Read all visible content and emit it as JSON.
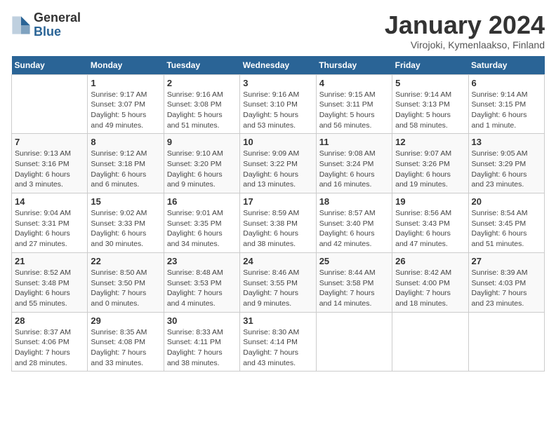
{
  "header": {
    "logo_general": "General",
    "logo_blue": "Blue",
    "title": "January 2024",
    "subtitle": "Virojoki, Kymenlaakso, Finland"
  },
  "weekdays": [
    "Sunday",
    "Monday",
    "Tuesday",
    "Wednesday",
    "Thursday",
    "Friday",
    "Saturday"
  ],
  "weeks": [
    [
      {
        "day": "",
        "info": ""
      },
      {
        "day": "1",
        "info": "Sunrise: 9:17 AM\nSunset: 3:07 PM\nDaylight: 5 hours\nand 49 minutes."
      },
      {
        "day": "2",
        "info": "Sunrise: 9:16 AM\nSunset: 3:08 PM\nDaylight: 5 hours\nand 51 minutes."
      },
      {
        "day": "3",
        "info": "Sunrise: 9:16 AM\nSunset: 3:10 PM\nDaylight: 5 hours\nand 53 minutes."
      },
      {
        "day": "4",
        "info": "Sunrise: 9:15 AM\nSunset: 3:11 PM\nDaylight: 5 hours\nand 56 minutes."
      },
      {
        "day": "5",
        "info": "Sunrise: 9:14 AM\nSunset: 3:13 PM\nDaylight: 5 hours\nand 58 minutes."
      },
      {
        "day": "6",
        "info": "Sunrise: 9:14 AM\nSunset: 3:15 PM\nDaylight: 6 hours\nand 1 minute."
      }
    ],
    [
      {
        "day": "7",
        "info": "Sunrise: 9:13 AM\nSunset: 3:16 PM\nDaylight: 6 hours\nand 3 minutes."
      },
      {
        "day": "8",
        "info": "Sunrise: 9:12 AM\nSunset: 3:18 PM\nDaylight: 6 hours\nand 6 minutes."
      },
      {
        "day": "9",
        "info": "Sunrise: 9:10 AM\nSunset: 3:20 PM\nDaylight: 6 hours\nand 9 minutes."
      },
      {
        "day": "10",
        "info": "Sunrise: 9:09 AM\nSunset: 3:22 PM\nDaylight: 6 hours\nand 13 minutes."
      },
      {
        "day": "11",
        "info": "Sunrise: 9:08 AM\nSunset: 3:24 PM\nDaylight: 6 hours\nand 16 minutes."
      },
      {
        "day": "12",
        "info": "Sunrise: 9:07 AM\nSunset: 3:26 PM\nDaylight: 6 hours\nand 19 minutes."
      },
      {
        "day": "13",
        "info": "Sunrise: 9:05 AM\nSunset: 3:29 PM\nDaylight: 6 hours\nand 23 minutes."
      }
    ],
    [
      {
        "day": "14",
        "info": "Sunrise: 9:04 AM\nSunset: 3:31 PM\nDaylight: 6 hours\nand 27 minutes."
      },
      {
        "day": "15",
        "info": "Sunrise: 9:02 AM\nSunset: 3:33 PM\nDaylight: 6 hours\nand 30 minutes."
      },
      {
        "day": "16",
        "info": "Sunrise: 9:01 AM\nSunset: 3:35 PM\nDaylight: 6 hours\nand 34 minutes."
      },
      {
        "day": "17",
        "info": "Sunrise: 8:59 AM\nSunset: 3:38 PM\nDaylight: 6 hours\nand 38 minutes."
      },
      {
        "day": "18",
        "info": "Sunrise: 8:57 AM\nSunset: 3:40 PM\nDaylight: 6 hours\nand 42 minutes."
      },
      {
        "day": "19",
        "info": "Sunrise: 8:56 AM\nSunset: 3:43 PM\nDaylight: 6 hours\nand 47 minutes."
      },
      {
        "day": "20",
        "info": "Sunrise: 8:54 AM\nSunset: 3:45 PM\nDaylight: 6 hours\nand 51 minutes."
      }
    ],
    [
      {
        "day": "21",
        "info": "Sunrise: 8:52 AM\nSunset: 3:48 PM\nDaylight: 6 hours\nand 55 minutes."
      },
      {
        "day": "22",
        "info": "Sunrise: 8:50 AM\nSunset: 3:50 PM\nDaylight: 7 hours\nand 0 minutes."
      },
      {
        "day": "23",
        "info": "Sunrise: 8:48 AM\nSunset: 3:53 PM\nDaylight: 7 hours\nand 4 minutes."
      },
      {
        "day": "24",
        "info": "Sunrise: 8:46 AM\nSunset: 3:55 PM\nDaylight: 7 hours\nand 9 minutes."
      },
      {
        "day": "25",
        "info": "Sunrise: 8:44 AM\nSunset: 3:58 PM\nDaylight: 7 hours\nand 14 minutes."
      },
      {
        "day": "26",
        "info": "Sunrise: 8:42 AM\nSunset: 4:00 PM\nDaylight: 7 hours\nand 18 minutes."
      },
      {
        "day": "27",
        "info": "Sunrise: 8:39 AM\nSunset: 4:03 PM\nDaylight: 7 hours\nand 23 minutes."
      }
    ],
    [
      {
        "day": "28",
        "info": "Sunrise: 8:37 AM\nSunset: 4:06 PM\nDaylight: 7 hours\nand 28 minutes."
      },
      {
        "day": "29",
        "info": "Sunrise: 8:35 AM\nSunset: 4:08 PM\nDaylight: 7 hours\nand 33 minutes."
      },
      {
        "day": "30",
        "info": "Sunrise: 8:33 AM\nSunset: 4:11 PM\nDaylight: 7 hours\nand 38 minutes."
      },
      {
        "day": "31",
        "info": "Sunrise: 8:30 AM\nSunset: 4:14 PM\nDaylight: 7 hours\nand 43 minutes."
      },
      {
        "day": "",
        "info": ""
      },
      {
        "day": "",
        "info": ""
      },
      {
        "day": "",
        "info": ""
      }
    ]
  ]
}
